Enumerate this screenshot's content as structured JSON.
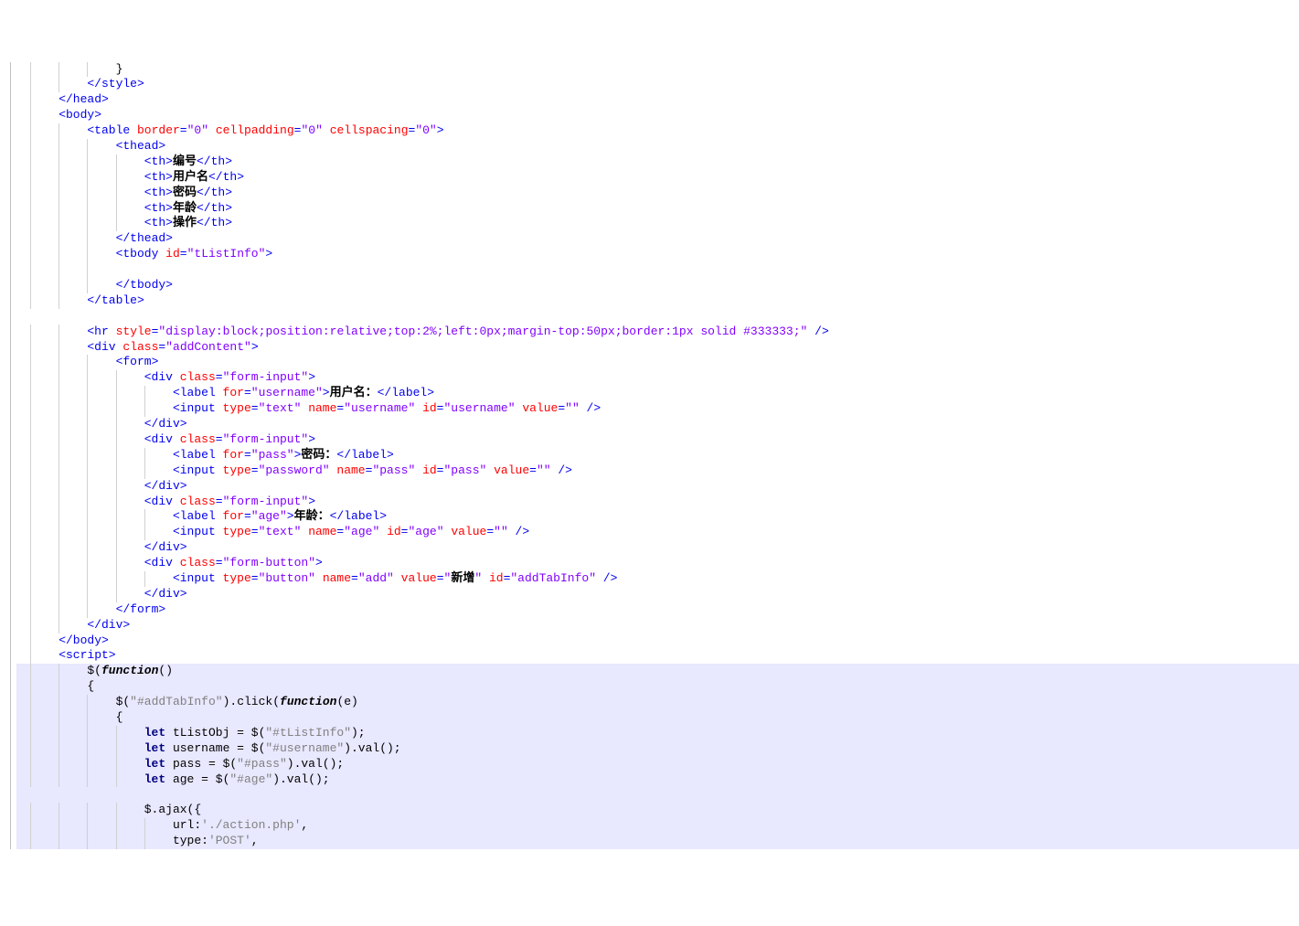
{
  "code_lines": [
    {
      "indent": 12,
      "hl": false,
      "segs": [
        {
          "t": "black",
          "v": "}"
        }
      ]
    },
    {
      "indent": 8,
      "hl": false,
      "segs": [
        {
          "t": "tag",
          "v": "</style>"
        }
      ]
    },
    {
      "indent": 4,
      "hl": false,
      "segs": [
        {
          "t": "tag",
          "v": "</head>"
        }
      ]
    },
    {
      "indent": 4,
      "hl": false,
      "segs": [
        {
          "t": "tag",
          "v": "<body>"
        }
      ]
    },
    {
      "indent": 8,
      "hl": false,
      "segs": [
        {
          "t": "tag",
          "v": "<table "
        },
        {
          "t": "attr",
          "v": "border"
        },
        {
          "t": "tag",
          "v": "="
        },
        {
          "t": "val",
          "v": "\"0\""
        },
        {
          "t": "tag",
          "v": " "
        },
        {
          "t": "attr",
          "v": "cellpadding"
        },
        {
          "t": "tag",
          "v": "="
        },
        {
          "t": "val",
          "v": "\"0\""
        },
        {
          "t": "tag",
          "v": " "
        },
        {
          "t": "attr",
          "v": "cellspacing"
        },
        {
          "t": "tag",
          "v": "="
        },
        {
          "t": "val",
          "v": "\"0\""
        },
        {
          "t": "tag",
          "v": ">"
        }
      ]
    },
    {
      "indent": 12,
      "hl": false,
      "segs": [
        {
          "t": "tag",
          "v": "<thead>"
        }
      ]
    },
    {
      "indent": 16,
      "hl": false,
      "segs": [
        {
          "t": "tag",
          "v": "<th>"
        },
        {
          "t": "text-black",
          "v": "编号"
        },
        {
          "t": "tag",
          "v": "</th>"
        }
      ]
    },
    {
      "indent": 16,
      "hl": false,
      "segs": [
        {
          "t": "tag",
          "v": "<th>"
        },
        {
          "t": "text-black",
          "v": "用户名"
        },
        {
          "t": "tag",
          "v": "</th>"
        }
      ]
    },
    {
      "indent": 16,
      "hl": false,
      "segs": [
        {
          "t": "tag",
          "v": "<th>"
        },
        {
          "t": "text-black",
          "v": "密码"
        },
        {
          "t": "tag",
          "v": "</th>"
        }
      ]
    },
    {
      "indent": 16,
      "hl": false,
      "segs": [
        {
          "t": "tag",
          "v": "<th>"
        },
        {
          "t": "text-black",
          "v": "年龄"
        },
        {
          "t": "tag",
          "v": "</th>"
        }
      ]
    },
    {
      "indent": 16,
      "hl": false,
      "segs": [
        {
          "t": "tag",
          "v": "<th>"
        },
        {
          "t": "text-black",
          "v": "操作"
        },
        {
          "t": "tag",
          "v": "</th>"
        }
      ]
    },
    {
      "indent": 12,
      "hl": false,
      "segs": [
        {
          "t": "tag",
          "v": "</thead>"
        }
      ]
    },
    {
      "indent": 12,
      "hl": false,
      "segs": [
        {
          "t": "tag",
          "v": "<tbody "
        },
        {
          "t": "attr",
          "v": "id"
        },
        {
          "t": "tag",
          "v": "="
        },
        {
          "t": "val",
          "v": "\"tListInfo\""
        },
        {
          "t": "tag",
          "v": ">"
        }
      ]
    },
    {
      "indent": 12,
      "hl": false,
      "segs": []
    },
    {
      "indent": 12,
      "hl": false,
      "segs": [
        {
          "t": "tag",
          "v": "</tbody>"
        }
      ]
    },
    {
      "indent": 8,
      "hl": false,
      "segs": [
        {
          "t": "tag",
          "v": "</table>"
        }
      ]
    },
    {
      "indent": 0,
      "hl": false,
      "segs": []
    },
    {
      "indent": 8,
      "hl": false,
      "segs": [
        {
          "t": "tag",
          "v": "<hr "
        },
        {
          "t": "attr",
          "v": "style"
        },
        {
          "t": "tag",
          "v": "="
        },
        {
          "t": "val",
          "v": "\"display:block;position:relative;top:2%;left:0px;margin-top:50px;border:1px solid #333333;\""
        },
        {
          "t": "tag",
          "v": " />"
        }
      ]
    },
    {
      "indent": 8,
      "hl": false,
      "segs": [
        {
          "t": "tag",
          "v": "<div "
        },
        {
          "t": "attr",
          "v": "class"
        },
        {
          "t": "tag",
          "v": "="
        },
        {
          "t": "val",
          "v": "\"addContent\""
        },
        {
          "t": "tag",
          "v": ">"
        }
      ]
    },
    {
      "indent": 12,
      "hl": false,
      "segs": [
        {
          "t": "tag",
          "v": "<form>"
        }
      ]
    },
    {
      "indent": 16,
      "hl": false,
      "segs": [
        {
          "t": "tag",
          "v": "<div "
        },
        {
          "t": "attr",
          "v": "class"
        },
        {
          "t": "tag",
          "v": "="
        },
        {
          "t": "val",
          "v": "\"form-input\""
        },
        {
          "t": "tag",
          "v": ">"
        }
      ]
    },
    {
      "indent": 20,
      "hl": false,
      "segs": [
        {
          "t": "tag",
          "v": "<label "
        },
        {
          "t": "attr",
          "v": "for"
        },
        {
          "t": "tag",
          "v": "="
        },
        {
          "t": "val",
          "v": "\"username\""
        },
        {
          "t": "tag",
          "v": ">"
        },
        {
          "t": "text-black",
          "v": "用户名："
        },
        {
          "t": "tag",
          "v": "</label>"
        }
      ]
    },
    {
      "indent": 20,
      "hl": false,
      "segs": [
        {
          "t": "tag",
          "v": "<input "
        },
        {
          "t": "attr",
          "v": "type"
        },
        {
          "t": "tag",
          "v": "="
        },
        {
          "t": "val",
          "v": "\"text\""
        },
        {
          "t": "tag",
          "v": " "
        },
        {
          "t": "attr",
          "v": "name"
        },
        {
          "t": "tag",
          "v": "="
        },
        {
          "t": "val",
          "v": "\"username\""
        },
        {
          "t": "tag",
          "v": " "
        },
        {
          "t": "attr",
          "v": "id"
        },
        {
          "t": "tag",
          "v": "="
        },
        {
          "t": "val",
          "v": "\"username\""
        },
        {
          "t": "tag",
          "v": " "
        },
        {
          "t": "attr",
          "v": "value"
        },
        {
          "t": "tag",
          "v": "="
        },
        {
          "t": "val",
          "v": "\"\""
        },
        {
          "t": "tag",
          "v": " />"
        }
      ]
    },
    {
      "indent": 16,
      "hl": false,
      "segs": [
        {
          "t": "tag",
          "v": "</div>"
        }
      ]
    },
    {
      "indent": 16,
      "hl": false,
      "segs": [
        {
          "t": "tag",
          "v": "<div "
        },
        {
          "t": "attr",
          "v": "class"
        },
        {
          "t": "tag",
          "v": "="
        },
        {
          "t": "val",
          "v": "\"form-input\""
        },
        {
          "t": "tag",
          "v": ">"
        }
      ]
    },
    {
      "indent": 20,
      "hl": false,
      "segs": [
        {
          "t": "tag",
          "v": "<label "
        },
        {
          "t": "attr",
          "v": "for"
        },
        {
          "t": "tag",
          "v": "="
        },
        {
          "t": "val",
          "v": "\"pass\""
        },
        {
          "t": "tag",
          "v": ">"
        },
        {
          "t": "text-black",
          "v": "密码："
        },
        {
          "t": "tag",
          "v": "</label>"
        }
      ]
    },
    {
      "indent": 20,
      "hl": false,
      "segs": [
        {
          "t": "tag",
          "v": "<input "
        },
        {
          "t": "attr",
          "v": "type"
        },
        {
          "t": "tag",
          "v": "="
        },
        {
          "t": "val",
          "v": "\"password\""
        },
        {
          "t": "tag",
          "v": " "
        },
        {
          "t": "attr",
          "v": "name"
        },
        {
          "t": "tag",
          "v": "="
        },
        {
          "t": "val",
          "v": "\"pass\""
        },
        {
          "t": "tag",
          "v": " "
        },
        {
          "t": "attr",
          "v": "id"
        },
        {
          "t": "tag",
          "v": "="
        },
        {
          "t": "val",
          "v": "\"pass\""
        },
        {
          "t": "tag",
          "v": " "
        },
        {
          "t": "attr",
          "v": "value"
        },
        {
          "t": "tag",
          "v": "="
        },
        {
          "t": "val",
          "v": "\"\""
        },
        {
          "t": "tag",
          "v": " />"
        }
      ]
    },
    {
      "indent": 16,
      "hl": false,
      "segs": [
        {
          "t": "tag",
          "v": "</div>"
        }
      ]
    },
    {
      "indent": 16,
      "hl": false,
      "segs": [
        {
          "t": "tag",
          "v": "<div "
        },
        {
          "t": "attr",
          "v": "class"
        },
        {
          "t": "tag",
          "v": "="
        },
        {
          "t": "val",
          "v": "\"form-input\""
        },
        {
          "t": "tag",
          "v": ">"
        }
      ]
    },
    {
      "indent": 20,
      "hl": false,
      "segs": [
        {
          "t": "tag",
          "v": "<label "
        },
        {
          "t": "attr",
          "v": "for"
        },
        {
          "t": "tag",
          "v": "="
        },
        {
          "t": "val",
          "v": "\"age\""
        },
        {
          "t": "tag",
          "v": ">"
        },
        {
          "t": "text-black",
          "v": "年龄："
        },
        {
          "t": "tag",
          "v": "</label>"
        }
      ]
    },
    {
      "indent": 20,
      "hl": false,
      "segs": [
        {
          "t": "tag",
          "v": "<input "
        },
        {
          "t": "attr",
          "v": "type"
        },
        {
          "t": "tag",
          "v": "="
        },
        {
          "t": "val",
          "v": "\"text\""
        },
        {
          "t": "tag",
          "v": " "
        },
        {
          "t": "attr",
          "v": "name"
        },
        {
          "t": "tag",
          "v": "="
        },
        {
          "t": "val",
          "v": "\"age\""
        },
        {
          "t": "tag",
          "v": " "
        },
        {
          "t": "attr",
          "v": "id"
        },
        {
          "t": "tag",
          "v": "="
        },
        {
          "t": "val",
          "v": "\"age\""
        },
        {
          "t": "tag",
          "v": " "
        },
        {
          "t": "attr",
          "v": "value"
        },
        {
          "t": "tag",
          "v": "="
        },
        {
          "t": "val",
          "v": "\"\""
        },
        {
          "t": "tag",
          "v": " />"
        }
      ]
    },
    {
      "indent": 16,
      "hl": false,
      "segs": [
        {
          "t": "tag",
          "v": "</div>"
        }
      ]
    },
    {
      "indent": 16,
      "hl": false,
      "segs": [
        {
          "t": "tag",
          "v": "<div "
        },
        {
          "t": "attr",
          "v": "class"
        },
        {
          "t": "tag",
          "v": "="
        },
        {
          "t": "val",
          "v": "\"form-button\""
        },
        {
          "t": "tag",
          "v": ">"
        }
      ]
    },
    {
      "indent": 20,
      "hl": false,
      "segs": [
        {
          "t": "tag",
          "v": "<input "
        },
        {
          "t": "attr",
          "v": "type"
        },
        {
          "t": "tag",
          "v": "="
        },
        {
          "t": "val",
          "v": "\"button\""
        },
        {
          "t": "tag",
          "v": " "
        },
        {
          "t": "attr",
          "v": "name"
        },
        {
          "t": "tag",
          "v": "="
        },
        {
          "t": "val",
          "v": "\"add\""
        },
        {
          "t": "tag",
          "v": " "
        },
        {
          "t": "attr",
          "v": "value"
        },
        {
          "t": "tag",
          "v": "="
        },
        {
          "t": "val",
          "v": "\""
        },
        {
          "t": "text-black",
          "v": "新增"
        },
        {
          "t": "val",
          "v": "\""
        },
        {
          "t": "tag",
          "v": " "
        },
        {
          "t": "attr",
          "v": "id"
        },
        {
          "t": "tag",
          "v": "="
        },
        {
          "t": "val",
          "v": "\"addTabInfo\""
        },
        {
          "t": "tag",
          "v": " />"
        }
      ]
    },
    {
      "indent": 16,
      "hl": false,
      "segs": [
        {
          "t": "tag",
          "v": "</div>"
        }
      ]
    },
    {
      "indent": 12,
      "hl": false,
      "segs": [
        {
          "t": "tag",
          "v": "</form>"
        }
      ]
    },
    {
      "indent": 8,
      "hl": false,
      "segs": [
        {
          "t": "tag",
          "v": "</div>"
        }
      ]
    },
    {
      "indent": 4,
      "hl": false,
      "segs": [
        {
          "t": "tag",
          "v": "</body>"
        }
      ]
    },
    {
      "indent": 4,
      "hl": false,
      "segs": [
        {
          "t": "tag",
          "v": "<script>"
        }
      ]
    },
    {
      "indent": 8,
      "hl": true,
      "segs": [
        {
          "t": "black",
          "v": "$("
        },
        {
          "t": "func-italic",
          "v": "function"
        },
        {
          "t": "black",
          "v": "()"
        }
      ]
    },
    {
      "indent": 8,
      "hl": true,
      "segs": [
        {
          "t": "black",
          "v": "{"
        }
      ]
    },
    {
      "indent": 12,
      "hl": true,
      "segs": [
        {
          "t": "black",
          "v": "$("
        },
        {
          "t": "str",
          "v": "\"#addTabInfo\""
        },
        {
          "t": "black",
          "v": ").click("
        },
        {
          "t": "func-italic",
          "v": "function"
        },
        {
          "t": "black",
          "v": "(e)"
        }
      ]
    },
    {
      "indent": 12,
      "hl": true,
      "segs": [
        {
          "t": "black",
          "v": "{"
        }
      ]
    },
    {
      "indent": 16,
      "hl": true,
      "segs": [
        {
          "t": "keyword-navy",
          "v": "let"
        },
        {
          "t": "black",
          "v": " tListObj = $("
        },
        {
          "t": "str",
          "v": "\"#tListInfo\""
        },
        {
          "t": "black",
          "v": ");"
        }
      ]
    },
    {
      "indent": 16,
      "hl": true,
      "segs": [
        {
          "t": "keyword-navy",
          "v": "let"
        },
        {
          "t": "black",
          "v": " username = $("
        },
        {
          "t": "str",
          "v": "\"#username\""
        },
        {
          "t": "black",
          "v": ").val();"
        }
      ]
    },
    {
      "indent": 16,
      "hl": true,
      "segs": [
        {
          "t": "keyword-navy",
          "v": "let"
        },
        {
          "t": "black",
          "v": " pass = $("
        },
        {
          "t": "str",
          "v": "\"#pass\""
        },
        {
          "t": "black",
          "v": ").val();"
        }
      ]
    },
    {
      "indent": 16,
      "hl": true,
      "segs": [
        {
          "t": "keyword-navy",
          "v": "let"
        },
        {
          "t": "black",
          "v": " age = $("
        },
        {
          "t": "str",
          "v": "\"#age\""
        },
        {
          "t": "black",
          "v": ").val();"
        }
      ]
    },
    {
      "indent": 0,
      "hl": true,
      "segs": []
    },
    {
      "indent": 16,
      "hl": true,
      "segs": [
        {
          "t": "black",
          "v": "$.ajax({"
        }
      ]
    },
    {
      "indent": 20,
      "hl": true,
      "segs": [
        {
          "t": "black",
          "v": "url:"
        },
        {
          "t": "str",
          "v": "'./action.php'"
        },
        {
          "t": "black",
          "v": ","
        }
      ]
    },
    {
      "indent": 20,
      "hl": true,
      "segs": [
        {
          "t": "black",
          "v": "type:"
        },
        {
          "t": "str",
          "v": "'POST'"
        },
        {
          "t": "black",
          "v": ","
        }
      ]
    }
  ]
}
